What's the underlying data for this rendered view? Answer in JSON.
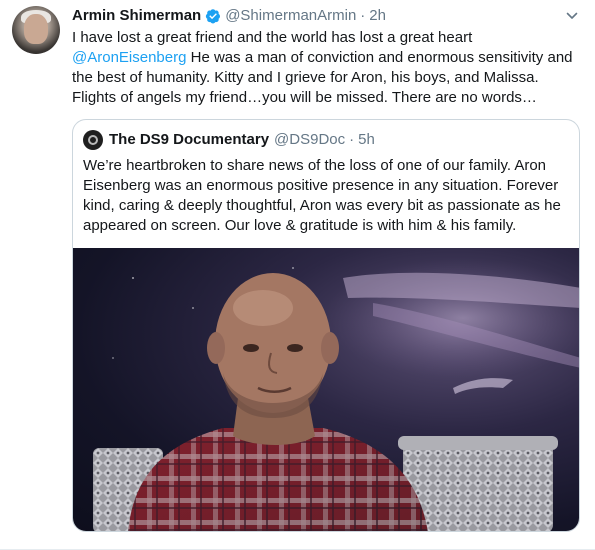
{
  "tweet": {
    "author_name": "Armin Shimerman",
    "handle": "@ShimermanArmin",
    "separator": "·",
    "time": "2h",
    "text_before_mention": "I have lost a great friend and the world has lost a great heart ",
    "mention": "@AronEisenberg",
    "text_after_mention": " He was a man of conviction and enormous sensitivity and the best of humanity. Kitty and I grieve for Aron, his boys, and Malissa. Flights of angels my friend…you will be missed. There are no words…"
  },
  "quoted_tweet": {
    "author_name": "The DS9 Documentary",
    "handle": "@DS9Doc",
    "separator": "·",
    "time": "5h",
    "text": "We’re heartbroken to share news of the loss of one of our family. Aron Eisenberg was an enormous positive presence in any situation. Forever kind, caring & deeply thoughtful, Aron was every bit as passionate as he appeared on screen. Our love & gratitude is with him & his family."
  },
  "icons": {
    "verified": "verified-badge-icon",
    "more": "chevron-down-icon"
  },
  "colors": {
    "link": "#1da1f2",
    "secondary_text": "#657786",
    "border": "#ccd6dd"
  }
}
